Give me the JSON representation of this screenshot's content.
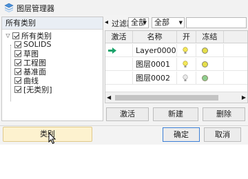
{
  "window": {
    "title": "图层管理器",
    "icon": "layer-manager-icon"
  },
  "left_panel": {
    "header": "所有类别",
    "tree": [
      {
        "label": "所有类别",
        "checked": true,
        "level": 0
      },
      {
        "label": "SOLIDS",
        "checked": true,
        "level": 1
      },
      {
        "label": "草图",
        "checked": true,
        "level": 1
      },
      {
        "label": "工程图",
        "checked": true,
        "level": 1
      },
      {
        "label": "基准面",
        "checked": true,
        "level": 1
      },
      {
        "label": "曲线",
        "checked": true,
        "level": 1
      },
      {
        "label": "[无类别]",
        "checked": true,
        "level": 1
      }
    ],
    "category_button": "类别"
  },
  "filter_bar": {
    "label": "过滤器",
    "select1": "全部",
    "select2": "全部",
    "text_filter": ""
  },
  "grid": {
    "columns": [
      "激活",
      "名称",
      "开",
      "冻结"
    ],
    "rows": [
      {
        "active": true,
        "name": "Layer0000",
        "on": true,
        "frozen": false,
        "color": "#e6df4a"
      },
      {
        "active": false,
        "name": "图层0001",
        "on": true,
        "frozen": false,
        "color": "#e6df4a"
      },
      {
        "active": false,
        "name": "图层0002",
        "on": false,
        "frozen": false,
        "color": "#8fcf8f"
      }
    ]
  },
  "actions": {
    "activate": "激活",
    "new": "新建",
    "delete": "删除"
  },
  "footer": {
    "ok": "确定",
    "cancel": "取消"
  },
  "colors": {
    "accent": "#3c7fd6",
    "highlight": "#fdf2cf",
    "active_arrow": "#1aa36b"
  }
}
